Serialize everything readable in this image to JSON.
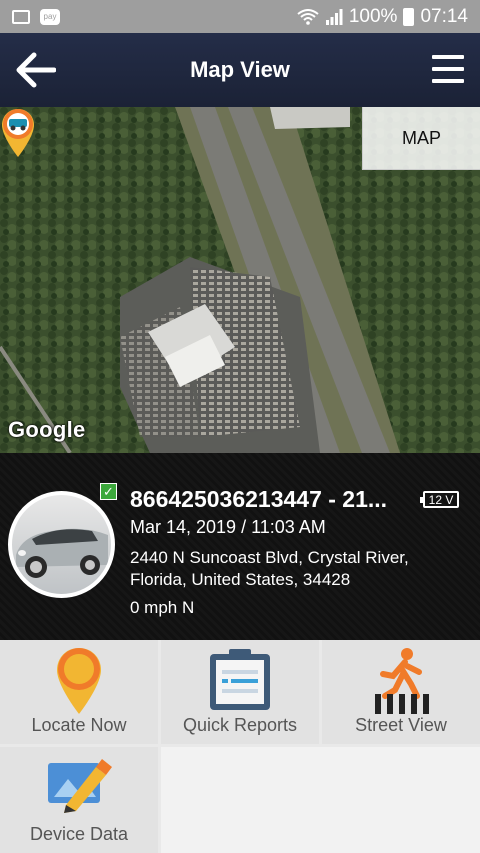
{
  "status_bar": {
    "battery_percent": "100%",
    "time": "07:14",
    "pay_label": "pay"
  },
  "header": {
    "title": "Map View"
  },
  "map": {
    "type_button": "MAP",
    "attribution": "Google"
  },
  "device": {
    "name": "866425036213447 - 21...",
    "voltage": "12 V",
    "datetime": "Mar 14, 2019 / 11:03 AM",
    "address": "2440 N Suncoast Blvd, Crystal River, Florida, United States, 34428",
    "speed": "0 mph N",
    "check_mark": "✓"
  },
  "actions": [
    {
      "label": "Locate Now",
      "icon": "location-pin-icon"
    },
    {
      "label": "Quick Reports",
      "icon": "clipboard-icon"
    },
    {
      "label": "Street View",
      "icon": "pedestrian-crossing-icon"
    },
    {
      "label": "Device Data",
      "icon": "edit-pencil-icon"
    }
  ],
  "colors": {
    "header_bg": "#1f2740",
    "accent_orange": "#f07b2a",
    "accent_yellow": "#f2b632",
    "tile_bg": "#e2e2e2"
  }
}
